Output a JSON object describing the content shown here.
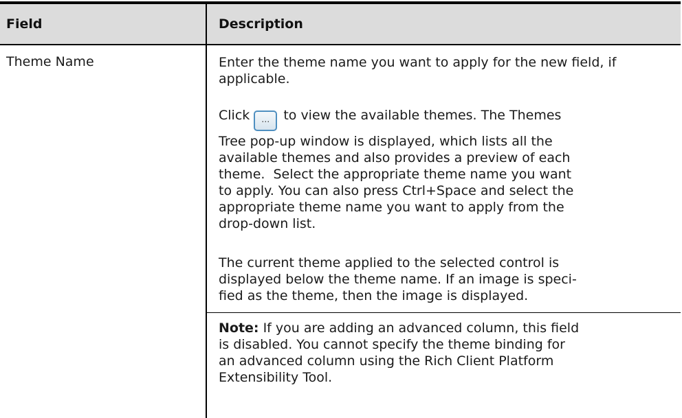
{
  "table": {
    "headers": {
      "field": "Field",
      "description": "Description"
    },
    "row": {
      "field": "Theme Name",
      "para1": "Enter the theme name you want to apply for the new field, if applicable.",
      "para2_before_button": "Click",
      "button_glyph": "…",
      "para2_line1_after": "to view the available themes. The Themes",
      "para2_rest": [
        "Tree pop-up window is displayed, which lists all the",
        "available themes and also provides a preview of each",
        "theme.  Select the appropriate theme name you want",
        "to apply. You can also press Ctrl+Space and select the",
        "appropriate theme name you want to apply from the",
        "drop-down list."
      ],
      "para3_lines": [
        "The current theme applied to the selected control is",
        "displayed below the theme name. If an image is speci-",
        "fied as the theme, then the image is displayed."
      ],
      "note_label": "Note:",
      "note_first_line": "If you are adding an advanced column, this field",
      "note_rest": [
        "is disabled. You cannot specify the theme binding for",
        "an advanced column using the Rich Client Platform",
        "Extensibility Tool."
      ]
    }
  }
}
